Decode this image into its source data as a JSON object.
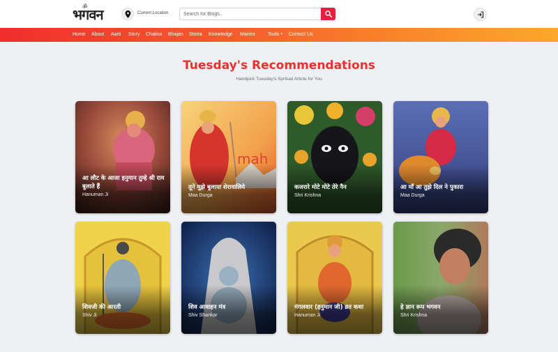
{
  "header": {
    "logo_text": "भगवन",
    "logo_om": "ॐ",
    "location_label": "Current Location",
    "search_placeholder": "Search for Blogs.."
  },
  "nav": {
    "items": [
      "Home",
      "About",
      "Aarti",
      "Story",
      "Chalisa",
      "Bhajan",
      "Stotra",
      "Knowledge",
      "Mantra",
      "Tools",
      "Contact Us"
    ],
    "tools_caret": "▾"
  },
  "section": {
    "title": "Tuesday's Recommendations",
    "subtitle": "Handpick Tuesday's Spritual Article for You"
  },
  "cards": [
    {
      "title": "आ लौट के आजा हनुमान तुम्हे श्री राम बुलाते हैं",
      "category": "Hanuman Ji"
    },
    {
      "title": "तूने मुझे बुलाया शेरावालिये",
      "category": "Maa Durga"
    },
    {
      "title": "कजरारे मोटे मोटे तेरे नैन",
      "category": "Shri Krishna"
    },
    {
      "title": "आ माँ आ तुझे दिल ने पुकारा",
      "category": "Maa Durga"
    },
    {
      "title": "शिवजी की आरती",
      "category": "Shiv Ji"
    },
    {
      "title": "शिव आवाहन मंत्र",
      "category": "Shiv Shankar"
    },
    {
      "title": "मंगलवार (हनुमान जी) व्रत कथा",
      "category": "Hanuman Ji"
    },
    {
      "title": "हे ज्ञान रूप भगवन",
      "category": "Shri Krishna"
    }
  ],
  "colors": {
    "accent_red": "#ef2e2e",
    "search_button": "#e8203f",
    "nav_gradient_start": "#f02d2d",
    "nav_gradient_end": "#fba82a"
  },
  "icons": {
    "location": "location-pin-icon",
    "search": "search-icon",
    "login": "login-icon"
  }
}
